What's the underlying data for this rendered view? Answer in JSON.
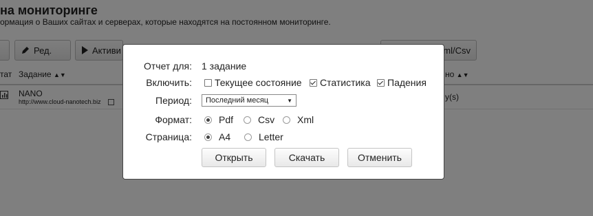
{
  "page": {
    "title": "на мониторинге",
    "subtitle": "ормация о Ваших сайтах и серверах, которые находятся на постоянном мониторинге."
  },
  "toolbar": {
    "edit_label": "Ред.",
    "activate_label": "Активи",
    "export_label": "ml/Csv"
  },
  "table": {
    "headers": {
      "status": "тат",
      "task": "Задание",
      "right": "но"
    },
    "row": {
      "name": "NANO",
      "url": "http://www.cloud-nanotech.biz",
      "right": "y(s)"
    }
  },
  "dialog": {
    "report_for_label": "Отчет для:",
    "report_for_value": "1 задание",
    "include_label": "Включить:",
    "include_options": [
      {
        "label": "Текущее состояние",
        "checked": false
      },
      {
        "label": "Статистика",
        "checked": true
      },
      {
        "label": "Падения",
        "checked": true
      }
    ],
    "period_label": "Период:",
    "period_value": "Последний месяц",
    "format_label": "Формат:",
    "format_options": [
      {
        "label": "Pdf",
        "selected": true
      },
      {
        "label": "Csv",
        "selected": false
      },
      {
        "label": "Xml",
        "selected": false
      }
    ],
    "page_label": "Страница:",
    "page_options": [
      {
        "label": "A4",
        "selected": true
      },
      {
        "label": "Letter",
        "selected": false
      }
    ],
    "buttons": {
      "open": "Открыть",
      "download": "Скачать",
      "cancel": "Отменить"
    }
  },
  "colors": {
    "overlay": "#000000",
    "dialog_border": "#444444"
  }
}
